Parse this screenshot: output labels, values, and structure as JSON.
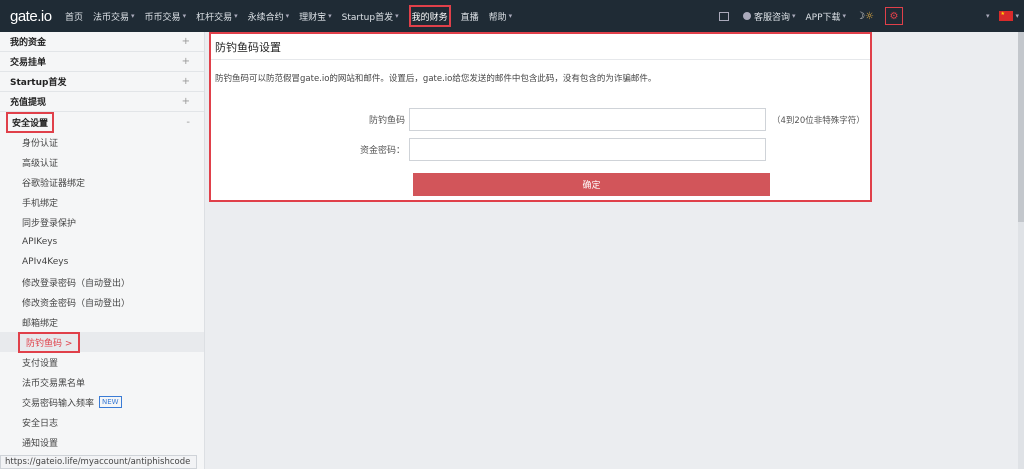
{
  "header": {
    "logo": "gate.io",
    "nav": [
      {
        "label": "首页",
        "dropdown": false
      },
      {
        "label": "法币交易",
        "dropdown": true
      },
      {
        "label": "币币交易",
        "dropdown": true
      },
      {
        "label": "杠杆交易",
        "dropdown": true
      },
      {
        "label": "永续合约",
        "dropdown": true
      },
      {
        "label": "理财宝",
        "dropdown": true
      },
      {
        "label": "Startup首发",
        "dropdown": true
      },
      {
        "label": "我的财务",
        "dropdown": false,
        "active": true
      },
      {
        "label": "直播",
        "dropdown": false
      },
      {
        "label": "帮助",
        "dropdown": true
      }
    ],
    "support_label": "客服咨询",
    "app_label": "APP下载"
  },
  "sidebar": {
    "sections": [
      {
        "label": "我的资金"
      },
      {
        "label": "交易挂单"
      },
      {
        "label": "Startup首发"
      },
      {
        "label": "充值提现"
      },
      {
        "label": "安全设置"
      }
    ],
    "security_items": [
      {
        "label": "身份认证"
      },
      {
        "label": "高级认证"
      },
      {
        "label": "谷歌验证器绑定"
      },
      {
        "label": "手机绑定"
      },
      {
        "label": "同步登录保护"
      },
      {
        "label": "APIKeys"
      },
      {
        "label": "APIv4Keys"
      },
      {
        "label": "修改登录密码（自动登出）"
      },
      {
        "label": "修改资金密码（自动登出）"
      },
      {
        "label": "邮箱绑定"
      },
      {
        "label": "防钓鱼码 >"
      },
      {
        "label": "支付设置"
      },
      {
        "label": "法币交易黑名单"
      },
      {
        "label": "交易密码输入频率",
        "badge": "NEW"
      },
      {
        "label": "安全日志"
      },
      {
        "label": "通知设置"
      }
    ]
  },
  "main": {
    "title": "防钓鱼码设置",
    "description": "防钓鱼码可以防范假冒gate.io的网站和邮件。设置后，gate.io给您发送的邮件中包含此码，没有包含的为诈骗邮件。",
    "fields": {
      "code_label": "防钓鱼码",
      "code_value": "",
      "code_hint": "（4到20位非特殊字符）",
      "password_label": "资金密码：",
      "password_value": ""
    },
    "confirm_label": "确定"
  },
  "status_url": "https://gateio.life/myaccount/antiphishcode",
  "colors": {
    "header_bg": "#1f2b35",
    "accent_red": "#e0404a",
    "button_bg": "#d2555a",
    "new_badge": "#3a7bd5"
  }
}
